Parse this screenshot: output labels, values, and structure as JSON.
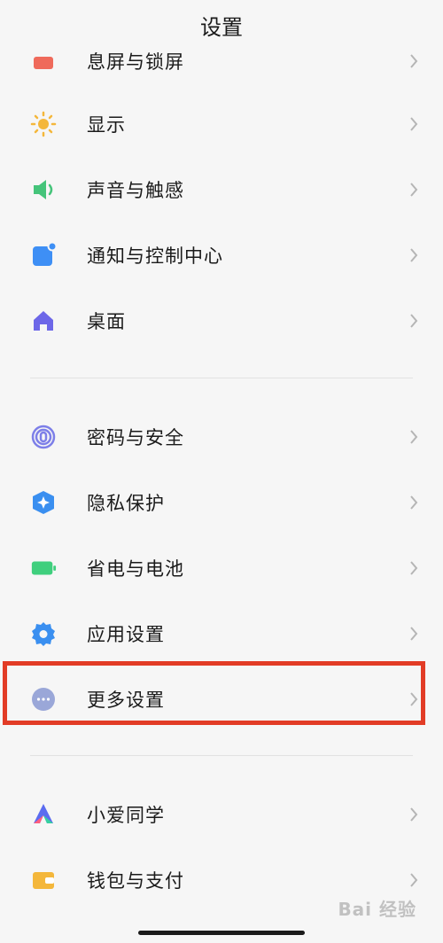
{
  "header": {
    "title": "设置"
  },
  "items": [
    {
      "id": "lock",
      "label": "息屏与锁屏",
      "icon": "lock-screen-icon",
      "color": "#ef6a5b"
    },
    {
      "id": "display",
      "label": "显示",
      "icon": "sun-icon",
      "color": "#f4b73b"
    },
    {
      "id": "sound",
      "label": "声音与触感",
      "icon": "speaker-icon",
      "color": "#45c47a"
    },
    {
      "id": "notify",
      "label": "通知与控制中心",
      "icon": "notification-icon",
      "color": "#3e8ff5"
    },
    {
      "id": "desktop",
      "label": "桌面",
      "icon": "home-icon",
      "color": "#6d67e8"
    },
    {
      "id": "password",
      "label": "密码与安全",
      "icon": "fingerprint-icon",
      "color": "#7d7fe8"
    },
    {
      "id": "privacy",
      "label": "隐私保护",
      "icon": "shield-icon",
      "color": "#3a8ff0"
    },
    {
      "id": "battery",
      "label": "省电与电池",
      "icon": "battery-icon",
      "color": "#3fcf7d"
    },
    {
      "id": "apps",
      "label": "应用设置",
      "icon": "gear-icon",
      "color": "#3a8ff0"
    },
    {
      "id": "more",
      "label": "更多设置",
      "icon": "more-icon",
      "color": "#9aa7d8"
    },
    {
      "id": "xiaoai",
      "label": "小爱同学",
      "icon": "xiaoai-icon",
      "color": "#5b6cf0"
    },
    {
      "id": "wallet",
      "label": "钱包与支付",
      "icon": "wallet-icon",
      "color": "#f4b73b"
    }
  ],
  "watermark": "Bai 经验"
}
